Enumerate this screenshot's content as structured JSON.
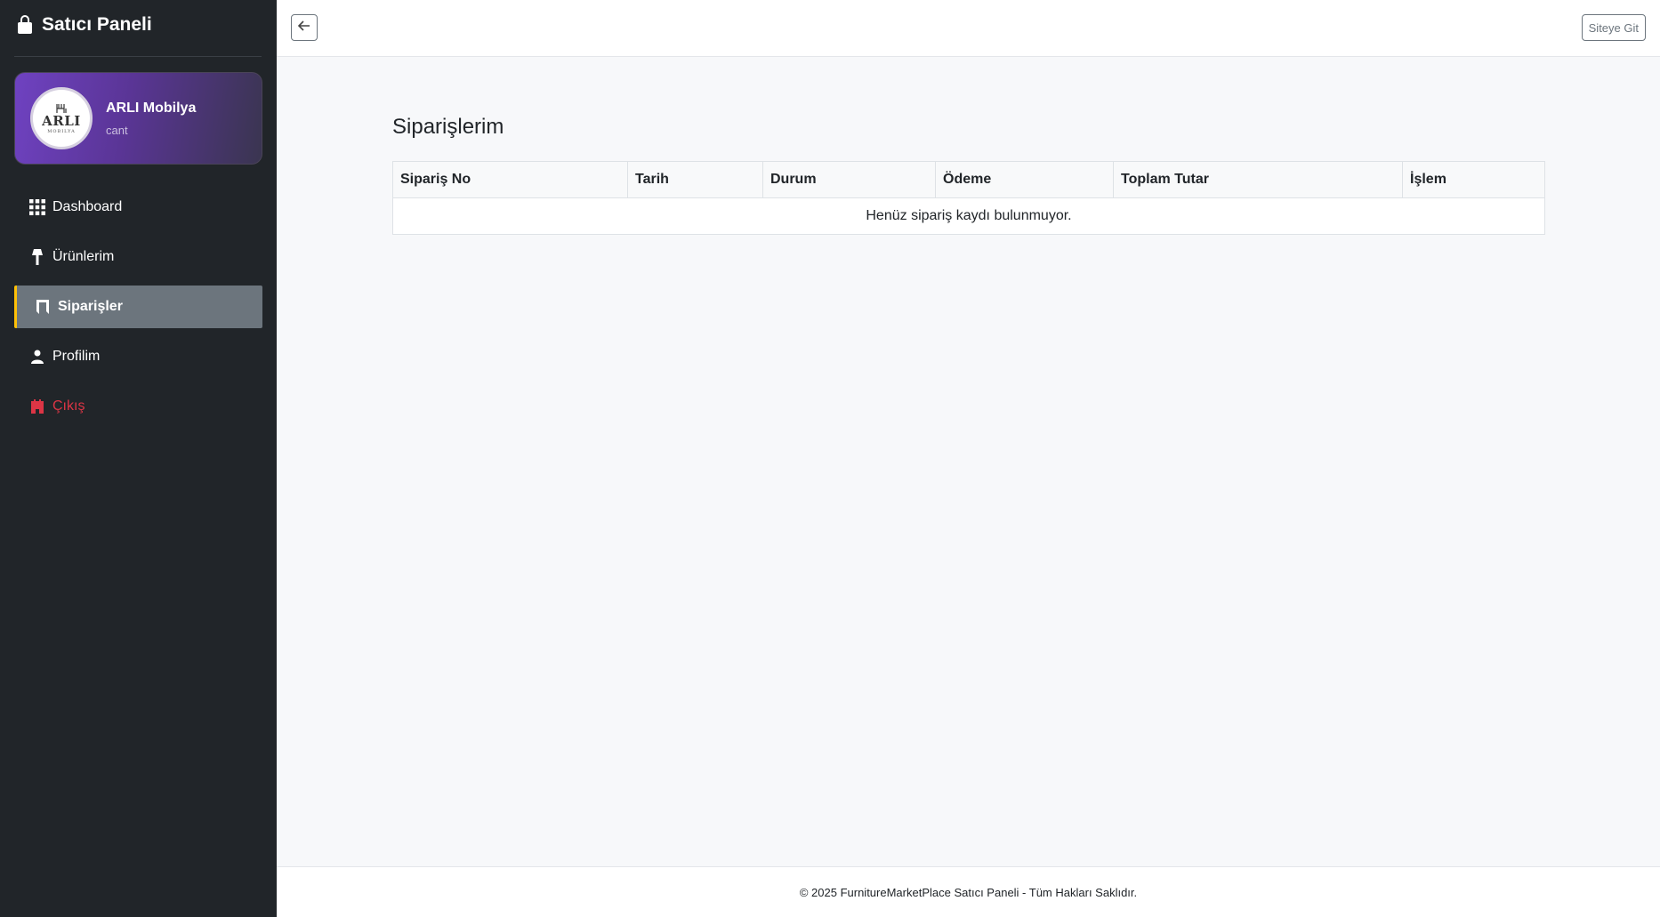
{
  "sidebar": {
    "brand_title": "Satıcı Paneli",
    "brand_icon": "bag-icon",
    "profile": {
      "logo_text": "ARLI",
      "logo_subtext": "MOBILYA",
      "name": "ARLI Mobilya",
      "username": "cant"
    },
    "items": [
      {
        "label": "Dashboard",
        "icon": "grid-icon",
        "active": false
      },
      {
        "label": "Ürünlerim",
        "icon": "lamp-icon",
        "active": false
      },
      {
        "label": "Siparişler",
        "icon": "bookmark-icon",
        "active": true
      },
      {
        "label": "Profilim",
        "icon": "user-icon",
        "active": false
      }
    ],
    "logout_label": "Çıkış"
  },
  "topbar": {
    "back_icon": "arrow-left-icon",
    "site_button_label": "Siteye Git"
  },
  "main": {
    "title": "Siparişlerim",
    "table": {
      "columns": [
        "Sipariş No",
        "Tarih",
        "Durum",
        "Ödeme",
        "Toplam Tutar",
        "İşlem"
      ],
      "empty_message": "Henüz sipariş kaydı bulunmuyor."
    }
  },
  "footer": {
    "text": "© 2025 FurnitureMarketPlace Satıcı Paneli - Tüm Hakları Saklıdır."
  },
  "colors": {
    "sidebar_bg": "#212529",
    "active_item_bg": "#6c757d",
    "active_accent": "#ffc107",
    "logout": "#dc3545",
    "profile_gradient_start": "#6f42c1"
  }
}
